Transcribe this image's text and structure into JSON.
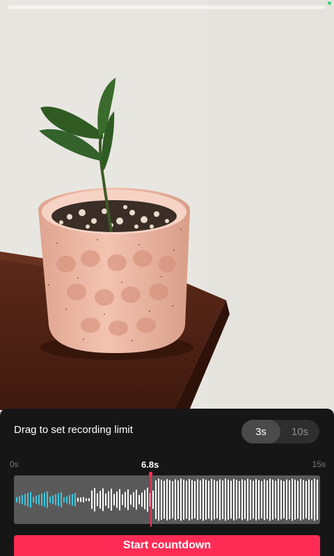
{
  "recording": {
    "progress": 0,
    "status_color": "#37d67a"
  },
  "panel": {
    "title": "Drag to set recording limit",
    "toggle": {
      "options": [
        "3s",
        "10s"
      ],
      "selected": "3s"
    },
    "timeline": {
      "start_label": "0s",
      "current_label": "6.8s",
      "end_label": "15s",
      "limit_seconds": 6.8,
      "total_seconds": 15
    },
    "start_button": "Start countdown"
  },
  "colors": {
    "accent": "#fe2c55",
    "played_wave": "#3fc6de",
    "unplayed_wave": "#ffffff"
  }
}
